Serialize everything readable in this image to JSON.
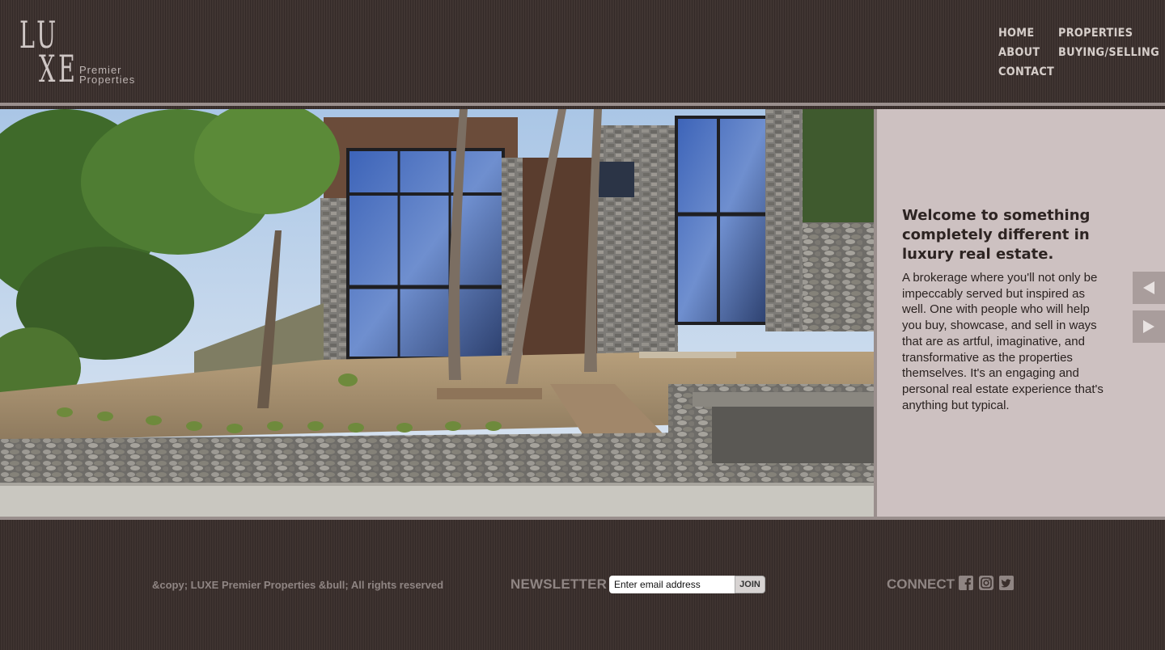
{
  "brand": {
    "logo_top": "LU",
    "logo_bottom": "XE",
    "subtitle_line1": "Premier",
    "subtitle_line2": "Properties"
  },
  "nav": {
    "home": "HOME",
    "properties": "PROPERTIES",
    "about": "ABOUT",
    "buying_selling": "BUYING/SELLING",
    "contact": "CONTACT"
  },
  "hero": {
    "heading": "Welcome to something completely different in luxury real estate.",
    "body": "A brokerage where you'll not only be impeccably served but inspired as well. One with people who will help you buy, showcase, and sell in ways that are as artful, imaginative, and transformative as the properties themselves. It's an engaging and personal real estate experience that's anything but typical.",
    "prev_icon": "triangle-left-icon",
    "next_icon": "triangle-right-icon"
  },
  "footer": {
    "copyright": "&copy; LUXE Premier Properties &bull; All rights reserved",
    "newsletter_label": "NEWSLETTER",
    "email_placeholder": "Enter email address",
    "join_label": "JOIN",
    "connect_label": "CONNECT",
    "social_icons": [
      "facebook-icon",
      "instagram-icon",
      "twitter-icon"
    ]
  },
  "colors": {
    "background": "#3b302d",
    "panel": "#cdc1c1",
    "accent_gray": "#9a8f8d",
    "footer_text": "#8f8583"
  }
}
